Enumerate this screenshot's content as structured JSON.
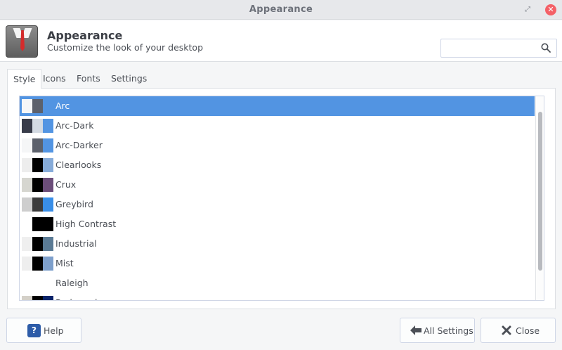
{
  "window": {
    "title": "Appearance",
    "close_glyph": "✕",
    "restore_glyph": "⤢"
  },
  "header": {
    "title": "Appearance",
    "subtitle": "Customize the look of your desktop",
    "icon": "appearance-suit-icon",
    "search": {
      "value": "",
      "placeholder": ""
    }
  },
  "tabs": [
    {
      "label": "Style",
      "active": true
    },
    {
      "label": "Icons",
      "active": false
    },
    {
      "label": "Fonts",
      "active": false
    },
    {
      "label": "Settings",
      "active": false
    }
  ],
  "themes": [
    {
      "name": "Arc",
      "selected": true,
      "swatches": [
        "#f5f6f7",
        "#5c616c",
        "#5294e2"
      ]
    },
    {
      "name": "Arc-Dark",
      "selected": false,
      "swatches": [
        "#383c4a",
        "#d3dae3",
        "#5294e2"
      ]
    },
    {
      "name": "Arc-Darker",
      "selected": false,
      "swatches": [
        "#f5f6f7",
        "#5c616c",
        "#5294e2"
      ]
    },
    {
      "name": "Clearlooks",
      "selected": false,
      "swatches": [
        "#ededed",
        "#000000",
        "#86abd9"
      ]
    },
    {
      "name": "Crux",
      "selected": false,
      "swatches": [
        "#d6d6d0",
        "#000000",
        "#6b4d79"
      ]
    },
    {
      "name": "Greybird",
      "selected": false,
      "swatches": [
        "#cecece",
        "#3c3c3c",
        "#398ee7"
      ]
    },
    {
      "name": "High Contrast",
      "selected": false,
      "swatches": [
        "#ffffff",
        "#000000",
        "#000000"
      ]
    },
    {
      "name": "Industrial",
      "selected": false,
      "swatches": [
        "#efefef",
        "#000000",
        "#5a7a94"
      ]
    },
    {
      "name": "Mist",
      "selected": false,
      "swatches": [
        "#eeeeee",
        "#000000",
        "#7d9fcb"
      ]
    },
    {
      "name": "Raleigh",
      "selected": false,
      "swatches": [
        "#ffffff",
        "#ffffff",
        "#ffffff"
      ]
    },
    {
      "name": "Redmond",
      "selected": false,
      "swatches": [
        "#d4d0c8",
        "#000000",
        "#0a246a"
      ]
    }
  ],
  "buttons": {
    "help": "Help",
    "all_settings": "All Settings",
    "close": "Close"
  },
  "colors": {
    "accent": "#5294e2",
    "close_button": "#f46067"
  }
}
